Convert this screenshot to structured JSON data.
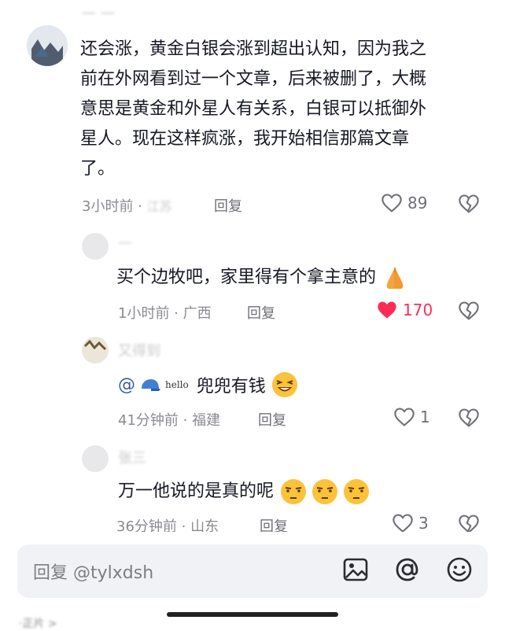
{
  "comments": [
    {
      "author_blurred": "一  一",
      "text_lines": [
        "还会涨，黄金白银会涨到超出认知，因为我之",
        "前在外网看到过一个文章，后来被删了，大概",
        "意思是黄金和外星人有关系，白银可以抵御外",
        "星人。现在这样疯涨，我开始相信那篇文章",
        "了。"
      ],
      "time": "3小时前 · ",
      "location_blurred": "江苏",
      "reply": "回复",
      "likes": "89",
      "liked": false
    },
    {
      "author_blurred": "—",
      "text": "买个边牧吧，家里得有个拿主意的",
      "emoji": "praying-hands",
      "time": "1小时前 · 广西",
      "reply": "回复",
      "likes": "170",
      "liked": true
    },
    {
      "author_blurred": "又得到",
      "mention_prefix": "@",
      "mention_hello": "hello",
      "text": "兜兜有钱",
      "emoji": "laughing-face",
      "time": "41分钟前 · 福建",
      "reply": "回复",
      "likes": "1",
      "liked": false
    },
    {
      "author_blurred": "张三",
      "text": "万一他说的是真的呢",
      "emoji": "unamused-face",
      "time": "36分钟前 · 山东",
      "reply": "回复",
      "likes": "3",
      "liked": false
    }
  ],
  "input": {
    "placeholder": "回复 @tylxdsh"
  },
  "toolbar_icons": [
    "image-icon",
    "at-icon",
    "emoji-icon"
  ],
  "corner_text": "·正片 >",
  "colors": {
    "accent_red": "#fe2c55",
    "mention_blue": "#385d9b",
    "meta_gray": "#8a8b91"
  }
}
